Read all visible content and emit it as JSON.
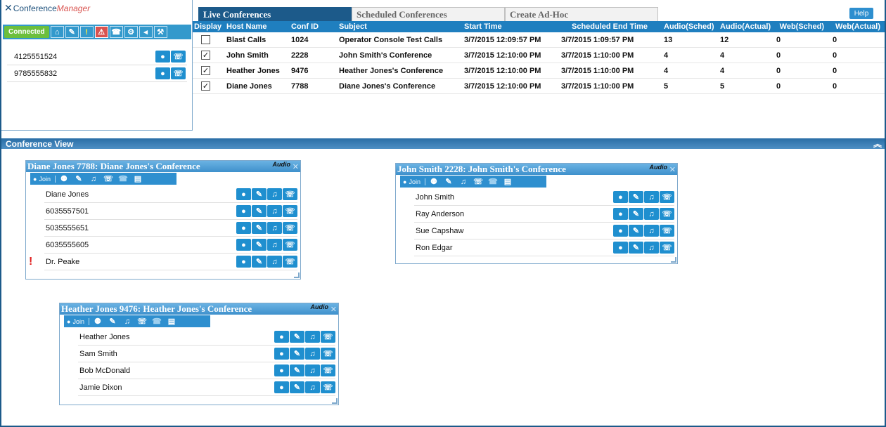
{
  "app": {
    "logo_part1": "Conference",
    "logo_part2": "Manager"
  },
  "toolbar": {
    "connected_label": "Connected",
    "icons": [
      "home-icon",
      "mute-icon",
      "warning-icon",
      "alert-icon",
      "phone-icon",
      "gear-icon",
      "back-icon",
      "wrench-icon"
    ]
  },
  "numbers": [
    "4125551524",
    "9785555832"
  ],
  "tabs": [
    {
      "label": "Live Conferences",
      "active": true
    },
    {
      "label": "Scheduled Conferences",
      "active": false
    },
    {
      "label": "Create Ad-Hoc",
      "active": false
    }
  ],
  "help_label": "Help",
  "table": {
    "headers": [
      "Display",
      "Host Name",
      "Conf ID",
      "Subject",
      "Start Time",
      "Scheduled End Time",
      "Audio(Sched)",
      "Audio(Actual)",
      "Web(Sched)",
      "Web(Actual)"
    ],
    "rows": [
      {
        "checked": false,
        "host": "Blast Calls",
        "conf_id": "1024",
        "subject": "Operator Console Test Calls",
        "start": "3/7/2015 12:09:57 PM",
        "end": "3/7/2015 1:09:57 PM",
        "audio_sched": "13",
        "audio_actual": "12",
        "web_sched": "0",
        "web_actual": "0"
      },
      {
        "checked": true,
        "host": "John Smith",
        "conf_id": "2228",
        "subject": "John Smith's Conference",
        "start": "3/7/2015 12:10:00 PM",
        "end": "3/7/2015 1:10:00 PM",
        "audio_sched": "4",
        "audio_actual": "4",
        "web_sched": "0",
        "web_actual": "0"
      },
      {
        "checked": true,
        "host": "Heather Jones",
        "conf_id": "9476",
        "subject": "Heather Jones's Conference",
        "start": "3/7/2015 12:10:00 PM",
        "end": "3/7/2015 1:10:00 PM",
        "audio_sched": "4",
        "audio_actual": "4",
        "web_sched": "0",
        "web_actual": "0"
      },
      {
        "checked": true,
        "host": "Diane Jones",
        "conf_id": "7788",
        "subject": "Diane Jones's Conference",
        "start": "3/7/2015 12:10:00 PM",
        "end": "3/7/2015 1:10:00 PM",
        "audio_sched": "5",
        "audio_actual": "5",
        "web_sched": "0",
        "web_actual": "0"
      }
    ]
  },
  "conference_view_label": "Conference View",
  "windows": [
    {
      "title": "Diane Jones 7788: Diane Jones's Conference",
      "audio_label": "Audio",
      "join_label": "Join",
      "participants": [
        {
          "name": "Diane Jones",
          "alert": false
        },
        {
          "name": "6035557501",
          "alert": false
        },
        {
          "name": "5035555651",
          "alert": false
        },
        {
          "name": "6035555605",
          "alert": false
        },
        {
          "name": "Dr. Peake",
          "alert": true
        }
      ]
    },
    {
      "title": "John Smith 2228: John Smith's Conference",
      "audio_label": "Audio",
      "join_label": "Join",
      "participants": [
        {
          "name": "John Smith",
          "alert": false
        },
        {
          "name": "Ray Anderson",
          "alert": false
        },
        {
          "name": "Sue Capshaw",
          "alert": false
        },
        {
          "name": "Ron Edgar",
          "alert": false
        }
      ]
    },
    {
      "title": "Heather Jones 9476: Heather Jones's Conference",
      "audio_label": "Audio",
      "join_label": "Join",
      "participants": [
        {
          "name": "Heather Jones",
          "alert": false
        },
        {
          "name": "Sam Smith",
          "alert": false
        },
        {
          "name": "Bob McDonald",
          "alert": false
        },
        {
          "name": "Jamie Dixon",
          "alert": false
        }
      ]
    }
  ]
}
